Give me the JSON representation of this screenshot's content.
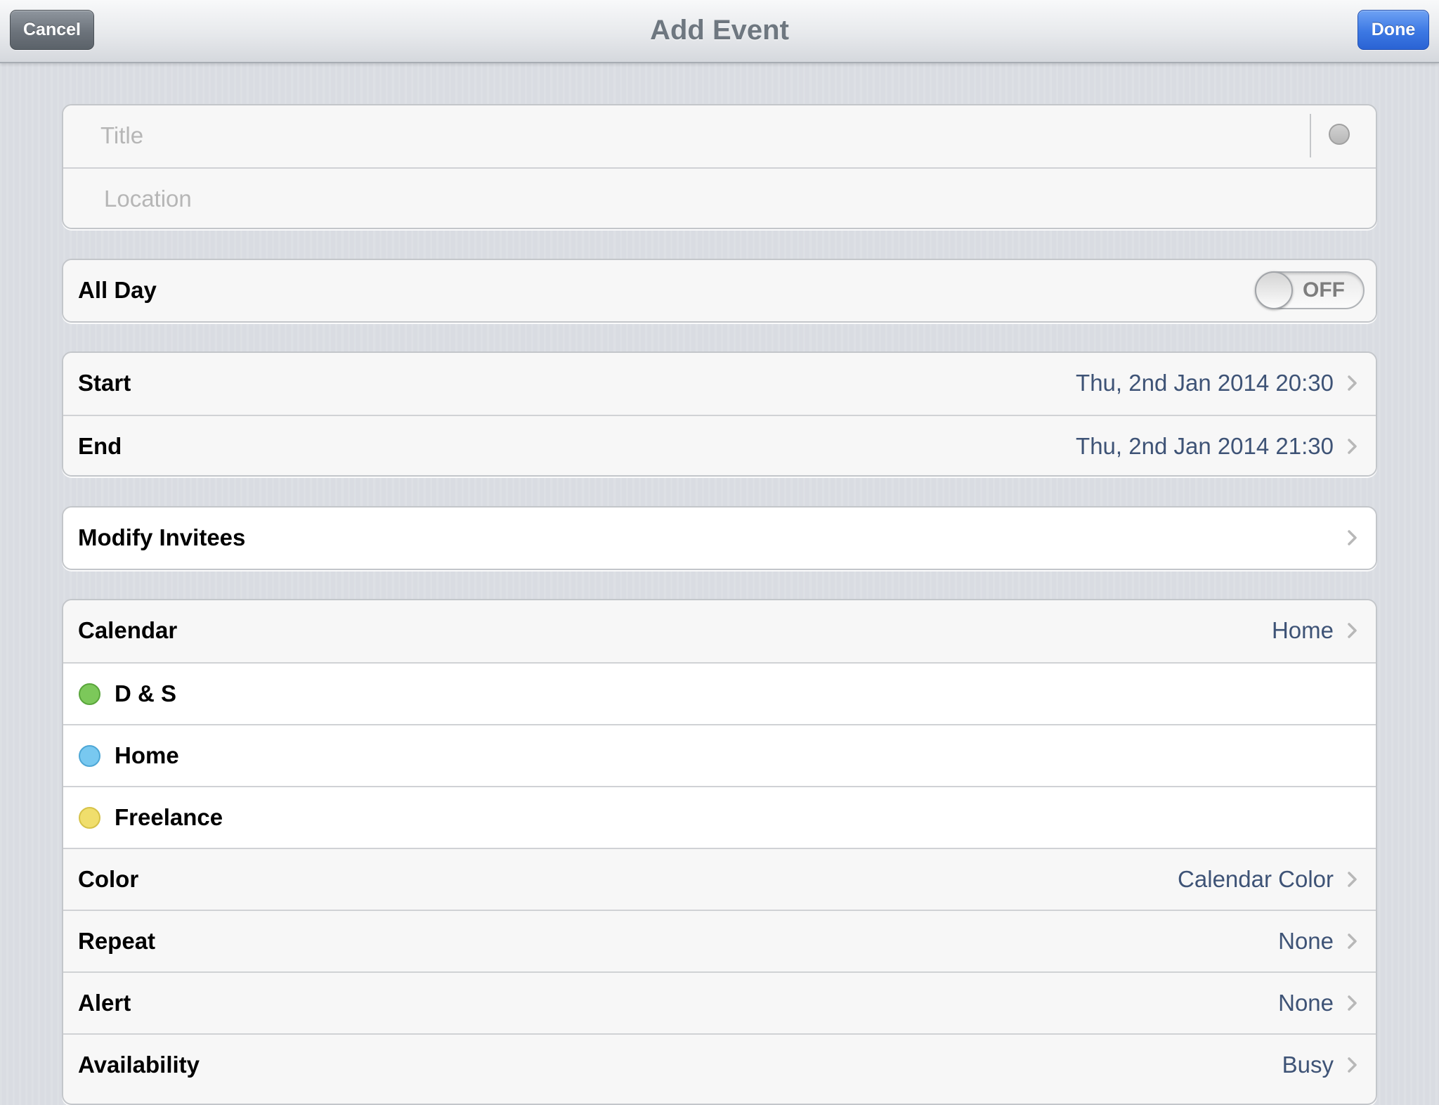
{
  "navbar": {
    "title": "Add Event",
    "cancel_label": "Cancel",
    "done_label": "Done"
  },
  "event_fields": {
    "title_placeholder": "Title",
    "location_placeholder": "Location",
    "title_color_icon": "circle-gray"
  },
  "all_day": {
    "label": "All Day",
    "toggle_state": "OFF"
  },
  "times": {
    "start_label": "Start",
    "start_value": "Thu, 2nd Jan 2014 20:30",
    "end_label": "End",
    "end_value": "Thu, 2nd Jan 2014 21:30"
  },
  "invitees": {
    "label": "Modify Invitees"
  },
  "settings": {
    "calendar_label": "Calendar",
    "calendar_value": "Home",
    "calendars": [
      {
        "name": "D & S",
        "color": "#7cc85a",
        "border": "#5aa63c"
      },
      {
        "name": "Home",
        "color": "#78c8f0",
        "border": "#4ea7d6"
      },
      {
        "name": "Freelance",
        "color": "#f0de6c",
        "border": "#d6c248"
      }
    ],
    "color_label": "Color",
    "color_value": "Calendar Color",
    "repeat_label": "Repeat",
    "repeat_value": "None",
    "alert_label": "Alert",
    "alert_value": "None",
    "availability_label": "Availability",
    "availability_value": "Busy"
  },
  "colors": {
    "value_text": "#3e5376",
    "done_button": "#3c78e3",
    "cancel_button": "#6c737b"
  },
  "icons": {
    "chevron": "chevron-right-icon"
  }
}
